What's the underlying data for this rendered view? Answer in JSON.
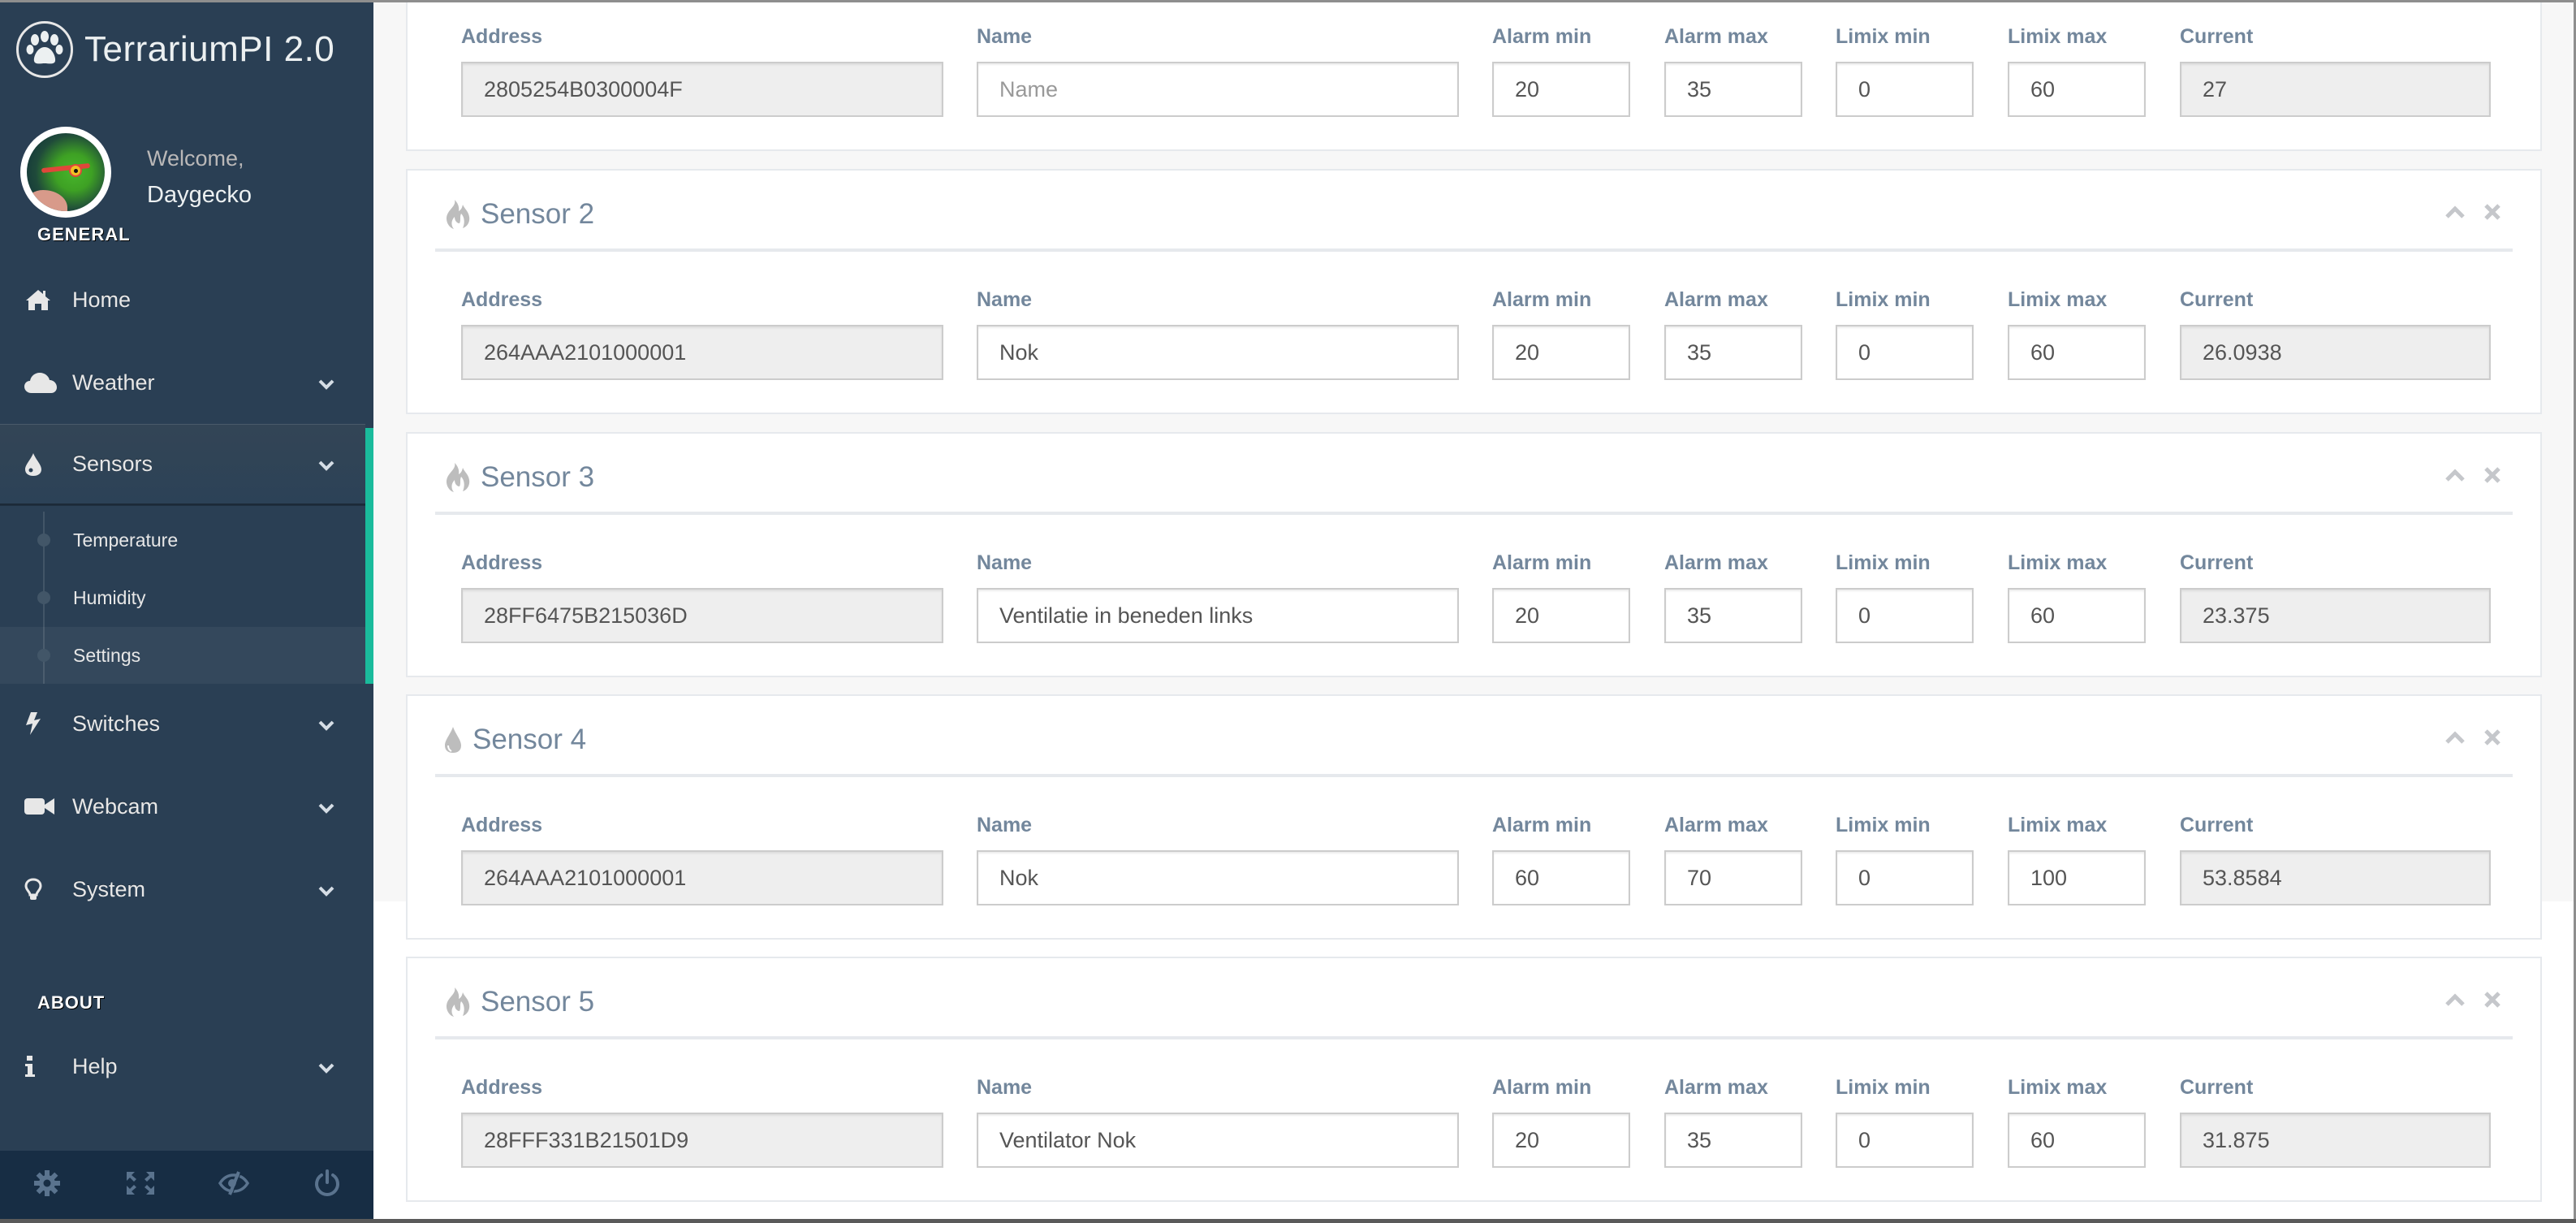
{
  "app": {
    "title": "TerrariumPI 2.0",
    "logo_icon": "paw-icon"
  },
  "profile": {
    "welcome": "Welcome,",
    "username": "Daygecko",
    "avatar": "gecko-avatar"
  },
  "sidebar": {
    "section_general": "GENERAL",
    "section_about": "ABOUT",
    "items": [
      {
        "label": "Home",
        "icon": "home-icon",
        "has_children": false
      },
      {
        "label": "Weather",
        "icon": "cloud-icon",
        "has_children": true
      },
      {
        "label": "Sensors",
        "icon": "tint-icon",
        "has_children": true,
        "active": true,
        "children": [
          {
            "label": "Temperature"
          },
          {
            "label": "Humidity"
          },
          {
            "label": "Settings",
            "current": true
          }
        ]
      },
      {
        "label": "Switches",
        "icon": "bolt-icon",
        "has_children": true
      },
      {
        "label": "Webcam",
        "icon": "video-camera-icon",
        "has_children": true
      },
      {
        "label": "System",
        "icon": "lightbulb-icon",
        "has_children": true
      }
    ],
    "about_items": [
      {
        "label": "Help",
        "icon": "info-icon",
        "has_children": true
      }
    ],
    "footer_buttons": [
      {
        "name": "settings",
        "icon": "gear-icon"
      },
      {
        "name": "fullscreen",
        "icon": "fullscreen-icon"
      },
      {
        "name": "lock",
        "icon": "eye-slash-icon"
      },
      {
        "name": "logout",
        "icon": "power-off-icon"
      }
    ],
    "accent_color": "#1ABB9C"
  },
  "labels": {
    "address": "Address",
    "name": "Name",
    "alarm_min": "Alarm min",
    "alarm_max": "Alarm max",
    "limit_min": "Limix min",
    "limit_max": "Limix max",
    "current": "Current",
    "name_placeholder": "Name"
  },
  "sensors": [
    {
      "title": "",
      "icon": "",
      "address": "2805254B0300004F",
      "name": "",
      "alarm_min": "20",
      "alarm_max": "35",
      "limit_min": "0",
      "limit_max": "60",
      "current": "27"
    },
    {
      "title": "Sensor 2",
      "icon": "fire-icon",
      "address": "264AAA2101000001",
      "name": "Nok",
      "alarm_min": "20",
      "alarm_max": "35",
      "limit_min": "0",
      "limit_max": "60",
      "current": "26.0938"
    },
    {
      "title": "Sensor 3",
      "icon": "fire-icon",
      "address": "28FF6475B215036D",
      "name": "Ventilatie in beneden links",
      "alarm_min": "20",
      "alarm_max": "35",
      "limit_min": "0",
      "limit_max": "60",
      "current": "23.375"
    },
    {
      "title": "Sensor 4",
      "icon": "tint-icon",
      "address": "264AAA2101000001",
      "name": "Nok",
      "alarm_min": "60",
      "alarm_max": "70",
      "limit_min": "0",
      "limit_max": "100",
      "current": "53.8584"
    },
    {
      "title": "Sensor 5",
      "icon": "fire-icon",
      "address": "28FFF331B21501D9",
      "name": "Ventilator Nok",
      "alarm_min": "20",
      "alarm_max": "35",
      "limit_min": "0",
      "limit_max": "60",
      "current": "31.875"
    }
  ]
}
